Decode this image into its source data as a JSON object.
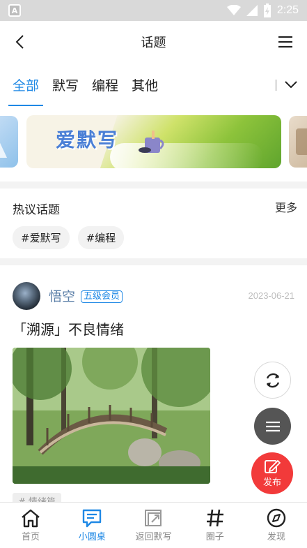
{
  "status_bar": {
    "time": "2:25",
    "app_icon_letter": "A",
    "icons": [
      "wifi-icon",
      "signal-icon",
      "battery-charging-icon"
    ]
  },
  "header": {
    "title": "话题",
    "back_icon": "chevron-left-icon",
    "menu_icon": "hamburger-menu-icon"
  },
  "tabs": [
    {
      "label": "全部",
      "active": true
    },
    {
      "label": "默写",
      "active": false
    },
    {
      "label": "编程",
      "active": false
    },
    {
      "label": "其他",
      "active": false
    }
  ],
  "banner": {
    "text": "爱默写"
  },
  "hot_topics": {
    "title": "热议话题",
    "more": "更多",
    "chips": [
      "#爱默写",
      "#编程"
    ]
  },
  "post": {
    "username": "悟空",
    "badge": "五级会员",
    "date": "2023-06-21",
    "title": "「溯源」不良情绪",
    "tag": "# 情绪篇"
  },
  "fabs": {
    "publish_label": "发布"
  },
  "bottom_nav": [
    {
      "label": "首页",
      "icon": "home-icon",
      "active": false
    },
    {
      "label": "小圆桌",
      "icon": "chat-icon",
      "active": true
    },
    {
      "label": "返回默写",
      "icon": "return-icon",
      "active": false
    },
    {
      "label": "圈子",
      "icon": "hash-icon",
      "active": false
    },
    {
      "label": "发现",
      "icon": "compass-icon",
      "active": false
    }
  ],
  "colors": {
    "accent": "#1e88e5",
    "publish": "#f23a3a",
    "fab_menu": "#555555"
  }
}
